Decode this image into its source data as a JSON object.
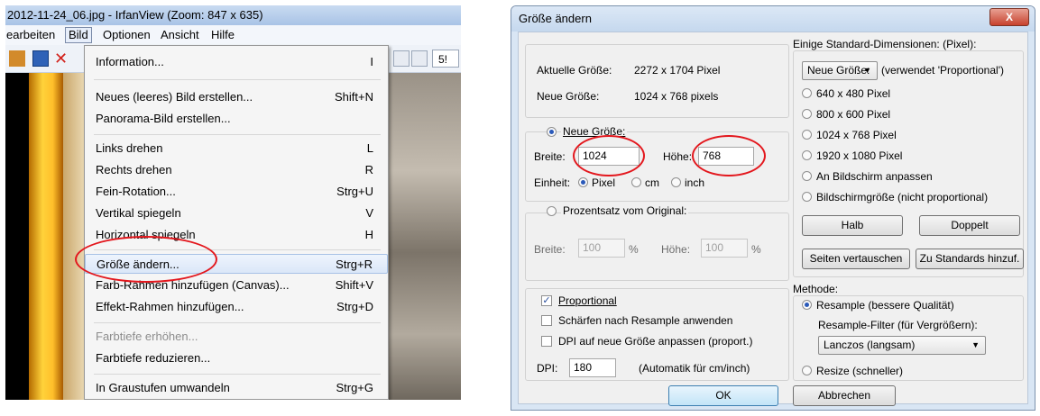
{
  "irfan": {
    "title": "2012-11-24_06.jpg - IrfanView (Zoom: 847 x 635)",
    "menubar": [
      "earbeiten",
      "Bild",
      "Optionen",
      "Ansicht",
      "Hilfe"
    ],
    "zoom_field": "5!",
    "bild_menu": [
      {
        "label": "Information...",
        "shortcut": "I"
      },
      {
        "label": "Neues (leeres) Bild erstellen...",
        "shortcut": "Shift+N"
      },
      {
        "label": "Panorama-Bild erstellen...",
        "shortcut": ""
      },
      {
        "label": "Links drehen",
        "shortcut": "L"
      },
      {
        "label": "Rechts drehen",
        "shortcut": "R"
      },
      {
        "label": "Fein-Rotation...",
        "shortcut": "Strg+U"
      },
      {
        "label": "Vertikal spiegeln",
        "shortcut": "V"
      },
      {
        "label": "Horizontal spiegeln",
        "shortcut": "H"
      },
      {
        "label": "Größe ändern...",
        "shortcut": "Strg+R"
      },
      {
        "label": "Farb-Rahmen hinzufügen (Canvas)...",
        "shortcut": "Shift+V"
      },
      {
        "label": "Effekt-Rahmen hinzufügen...",
        "shortcut": "Strg+D"
      },
      {
        "label": "Farbtiefe erhöhen...",
        "shortcut": ""
      },
      {
        "label": "Farbtiefe reduzieren...",
        "shortcut": ""
      },
      {
        "label": "In Graustufen umwandeln",
        "shortcut": "Strg+G"
      }
    ]
  },
  "dialog": {
    "title": "Größe ändern",
    "close": "X",
    "current_size_label": "Aktuelle Größe:",
    "current_size_value": "2272 x 1704 Pixel",
    "new_size_label": "Neue Größe:",
    "new_size_value": "1024 x 768 pixels",
    "radio_neue_groesse": "Neue Größe:",
    "breite_label": "Breite:",
    "breite_value": "1024",
    "hoehe_label": "Höhe:",
    "hoehe_value": "768",
    "einheit_label": "Einheit:",
    "unit_pixel": "Pixel",
    "unit_cm": "cm",
    "unit_inch": "inch",
    "radio_prozent": "Prozentsatz vom Original:",
    "pct_breite_label": "Breite:",
    "pct_breite_value": "100",
    "pct_symbol": "%",
    "pct_hoehe_label": "Höhe:",
    "pct_hoehe_value": "100",
    "std_dims_label": "Einige Standard-Dimensionen: (Pixel):",
    "std_select": "Neue Größe:",
    "std_select_note": "(verwendet 'Proportional')",
    "std_options": [
      "640 x 480 Pixel",
      "800 x 600 Pixel",
      "1024 x 768 Pixel",
      "1920 x 1080 Pixel",
      "An Bildschirm anpassen",
      "Bildschirmgröße (nicht proportional)"
    ],
    "btn_halb": "Halb",
    "btn_doppelt": "Doppelt",
    "btn_seiten": "Seiten vertauschen",
    "btn_standards": "Zu Standards hinzuf.",
    "chk_proportional": "Proportional",
    "chk_schaerfen": "Schärfen nach Resample anwenden",
    "chk_dpi": "DPI auf neue Größe anpassen (proport.)",
    "dpi_label": "DPI:",
    "dpi_value": "180",
    "dpi_note": "(Automatik für cm/inch)",
    "methode_label": "Methode:",
    "radio_resample": "Resample (bessere Qualität)",
    "filter_label": "Resample-Filter (für Vergrößern):",
    "filter_value": "Lanczos (langsam)",
    "radio_resize": "Resize (schneller)",
    "btn_ok": "OK",
    "btn_abbrechen": "Abbrechen"
  }
}
